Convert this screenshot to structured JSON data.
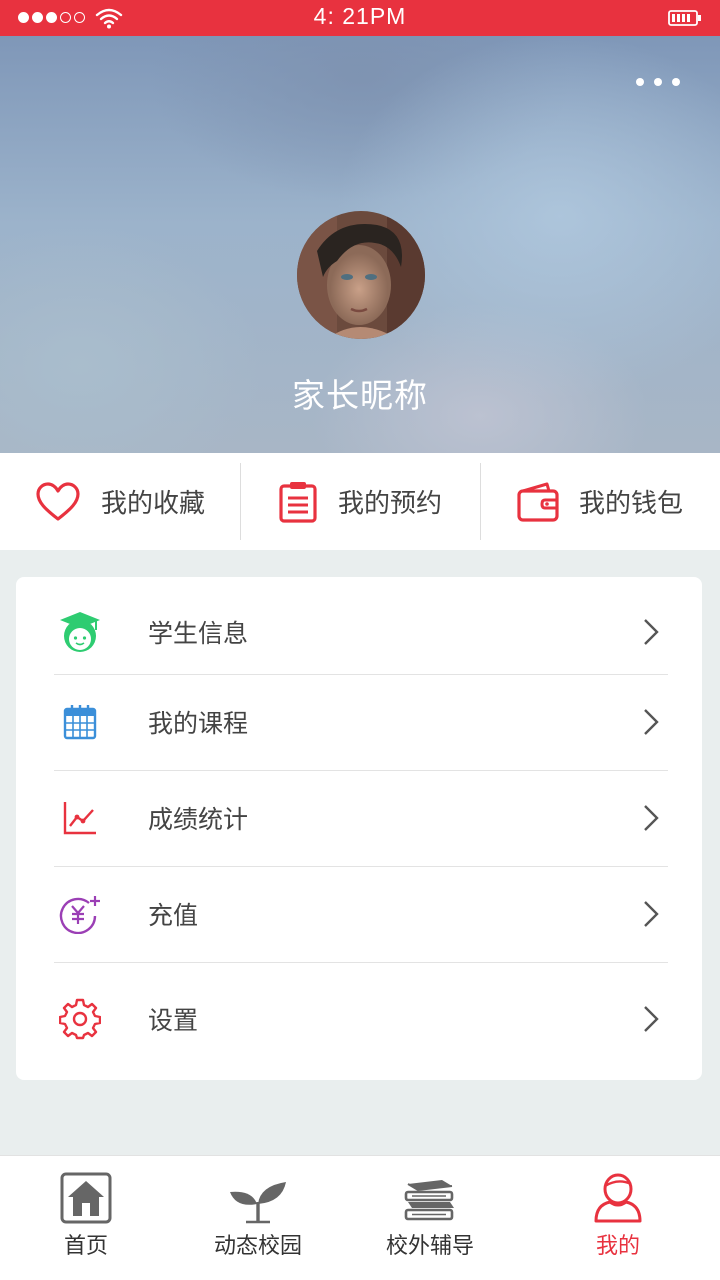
{
  "status_bar": {
    "time": "4: 21PM",
    "signal_icon": "signal-dots-icon",
    "wifi_icon": "wifi-icon",
    "battery_icon": "battery-icon",
    "color": "#e8323f"
  },
  "profile": {
    "more_icon": "more-dots-icon",
    "avatar": "avatar-photo",
    "nickname": "家长昵称"
  },
  "quick_actions": [
    {
      "label": "我的收藏",
      "icon": "heart-icon"
    },
    {
      "label": "我的预约",
      "icon": "clipboard-icon"
    },
    {
      "label": "我的钱包",
      "icon": "wallet-icon"
    }
  ],
  "menu": [
    {
      "label": "学生信息",
      "icon": "graduate-student-icon",
      "icon_color": "#2ecc71"
    },
    {
      "label": "我的课程",
      "icon": "calendar-icon",
      "icon_color": "#3b8fd9"
    },
    {
      "label": "成绩统计",
      "icon": "line-chart-icon",
      "icon_color": "#e8323f"
    },
    {
      "label": "充值",
      "icon": "yuan-coin-icon",
      "icon_color": "#9b3fb5"
    },
    {
      "label": "设置",
      "icon": "gear-icon",
      "icon_color": "#e8323f"
    }
  ],
  "tab_bar": {
    "active_index": 3,
    "items": [
      {
        "label": "首页",
        "icon": "home-icon"
      },
      {
        "label": "动态校园",
        "icon": "sprout-icon"
      },
      {
        "label": "校外辅导",
        "icon": "books-icon"
      },
      {
        "label": "我的",
        "icon": "user-icon"
      }
    ]
  },
  "colors": {
    "accent": "#e8323f",
    "text": "#444444",
    "background": "#e9eeee"
  }
}
